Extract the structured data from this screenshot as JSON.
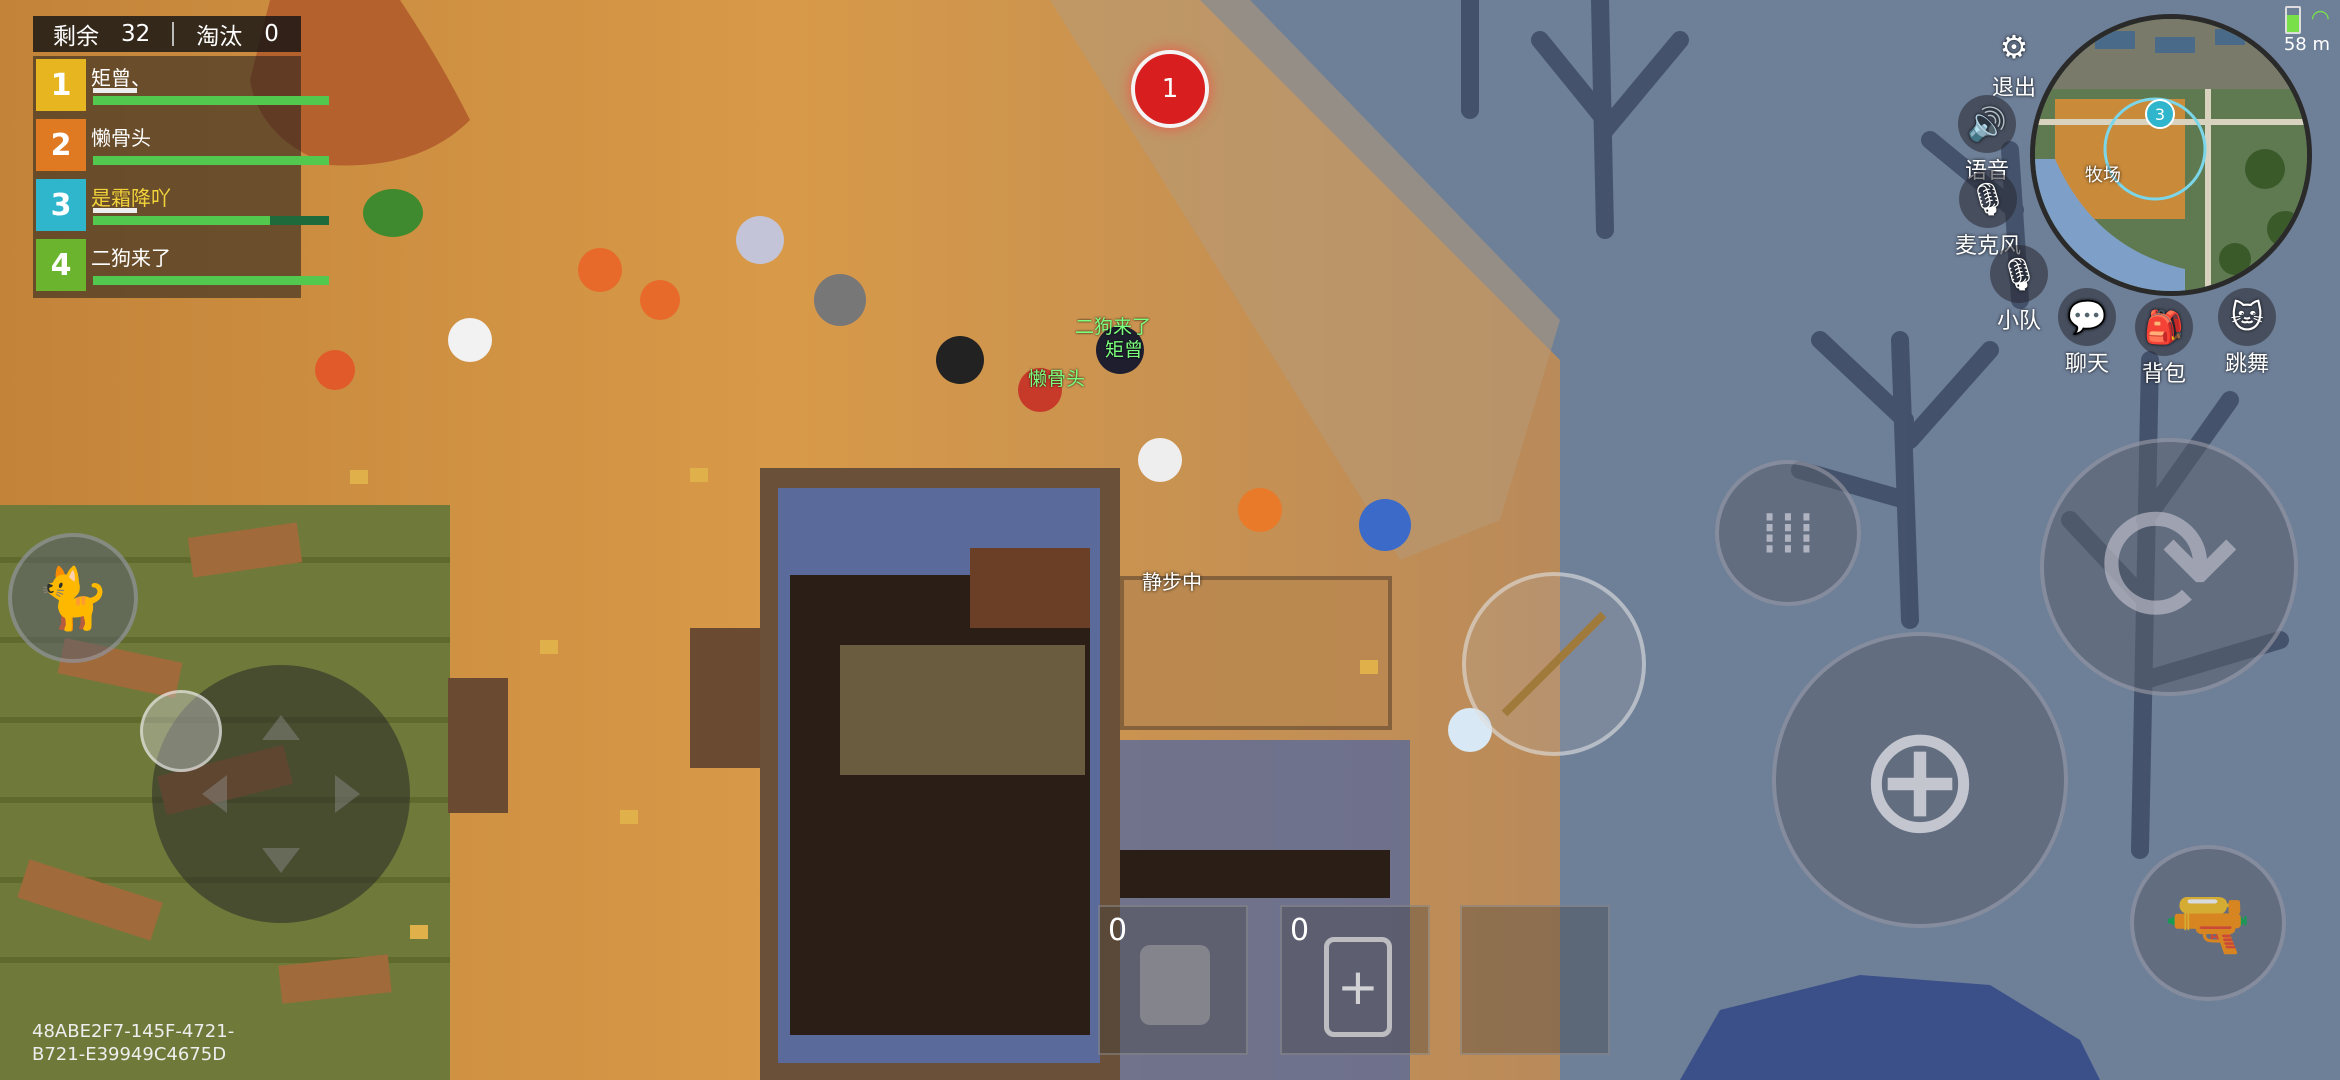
{
  "hud": {
    "remaining_label": "剩余",
    "remaining_value": "32",
    "eliminated_label": "淘汰",
    "eliminated_value": "0"
  },
  "team": [
    {
      "rank": "1",
      "name": "矩曾、",
      "badge_color": "#e6b520",
      "hp": 1.0,
      "has_armor": true
    },
    {
      "rank": "2",
      "name": "懒骨头",
      "badge_color": "#e07a22",
      "hp": 1.0,
      "has_armor": false
    },
    {
      "rank": "3",
      "name": "是霜降吖",
      "badge_color": "#2fb6cc",
      "hp": 0.75,
      "has_armor": true,
      "name_color": "#f2d33a"
    },
    {
      "rank": "4",
      "name": "二狗来了",
      "badge_color": "#6bb42e",
      "hp": 1.0,
      "has_armor": false
    }
  ],
  "alert_count": "1",
  "world_labels": {
    "sneak_status": "静步中",
    "player_tags": [
      "二狗来了",
      "矩曾",
      "懒骨头"
    ]
  },
  "menu": {
    "exit": "退出",
    "voice": "语音",
    "mic": "麦克风",
    "squad": "小队",
    "chat": "聊天",
    "backpack": "背包",
    "dance": "跳舞"
  },
  "minimap": {
    "place_label": "牧场",
    "marker_number": "3"
  },
  "status": {
    "distance": "58 m"
  },
  "slots": [
    {
      "count": "0",
      "item": "bandage-icon"
    },
    {
      "count": "0",
      "item": "medkit-icon"
    },
    {
      "count": "",
      "item": "empty"
    }
  ],
  "session_id_line1": "48ABE2F7-145F-4721-",
  "session_id_line2": "B721-E39949C4675D",
  "colors": {
    "sand": "#c98a3a",
    "water": "#6b7d9a",
    "hp_green": "#52c84e",
    "alert_red": "#d81e1e"
  }
}
